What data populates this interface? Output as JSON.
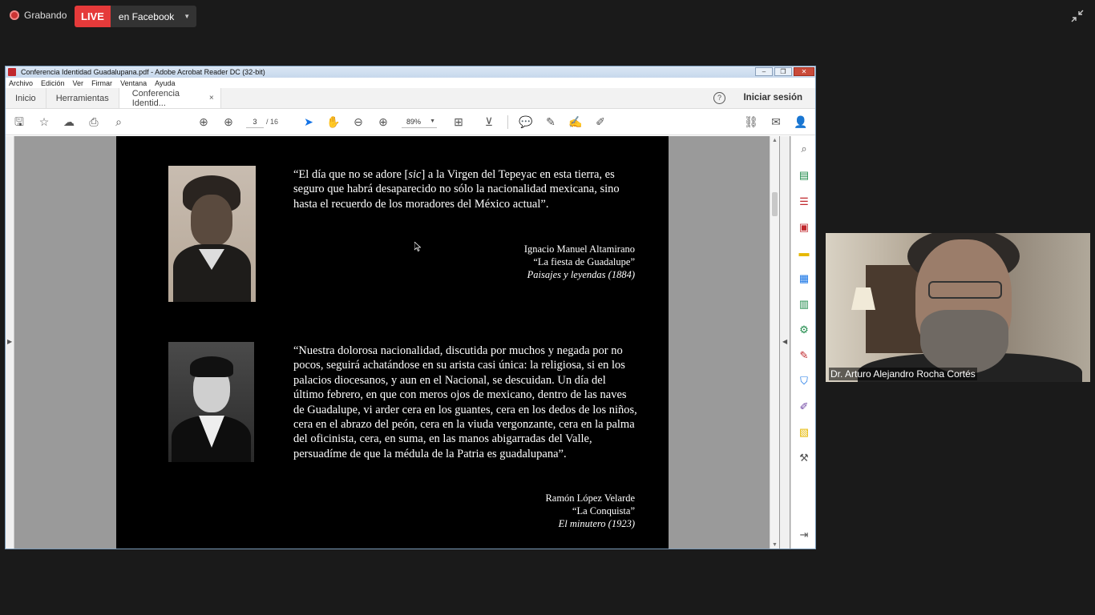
{
  "zoom_bar": {
    "recording_label": "Grabando",
    "live_label": "LIVE",
    "platform_label": "en Facebook"
  },
  "acrobat": {
    "window_title": "Conferencia Identidad Guadalupana.pdf - Adobe Acrobat Reader DC (32-bit)",
    "menu": [
      "Archivo",
      "Edición",
      "Ver",
      "Firmar",
      "Ventana",
      "Ayuda"
    ],
    "tabs": {
      "home": "Inicio",
      "tools": "Herramientas",
      "document": "Conferencia Identid...",
      "close": "×"
    },
    "help": "?",
    "sign_in": "Iniciar sesión",
    "toolbar": {
      "current_page": "3",
      "total_pages": "/ 16",
      "zoom": "89%"
    }
  },
  "page": {
    "quote1": {
      "text_before": "“El día que no se adore [",
      "text_sic": "sic",
      "text_after": "] a la Virgen del Tepeyac en esta tierra, es seguro que habrá desaparecido no sólo la nacionalidad mexicana, sino hasta el recuerdo de los moradores del México actual”.",
      "author": "Ignacio Manuel Altamirano",
      "work": "“La fiesta de Guadalupe”",
      "book": "Paisajes y leyendas (1884)"
    },
    "quote2": {
      "text": "“Nuestra dolorosa nacionalidad, discutida por muchos y negada por no pocos, seguirá achatándose en su arista casi única: la religiosa, si en los palacios diocesanos, y aun en el Nacional, se descuidan. Un día del último febrero, en que con meros ojos de mexicano, dentro de las naves de Guadalupe, vi arder cera en los guantes, cera en los dedos de los niños, cera en el abrazo del peón, cera en la viuda vergonzante, cera en la palma del oficinista, cera, en suma, en las manos abigarradas del Valle, persuadíme de que la médula de la Patria es guadalupana”.",
      "author": "Ramón López Velarde",
      "work": "“La Conquista”",
      "book": "El minutero (1923)"
    }
  },
  "video": {
    "participant_name": "Dr. Arturo Alejandro Rocha Cortés"
  },
  "colors": {
    "live": "#e53a3a",
    "acrobat_blue": "#1473e6",
    "page_bg": "#000000"
  }
}
